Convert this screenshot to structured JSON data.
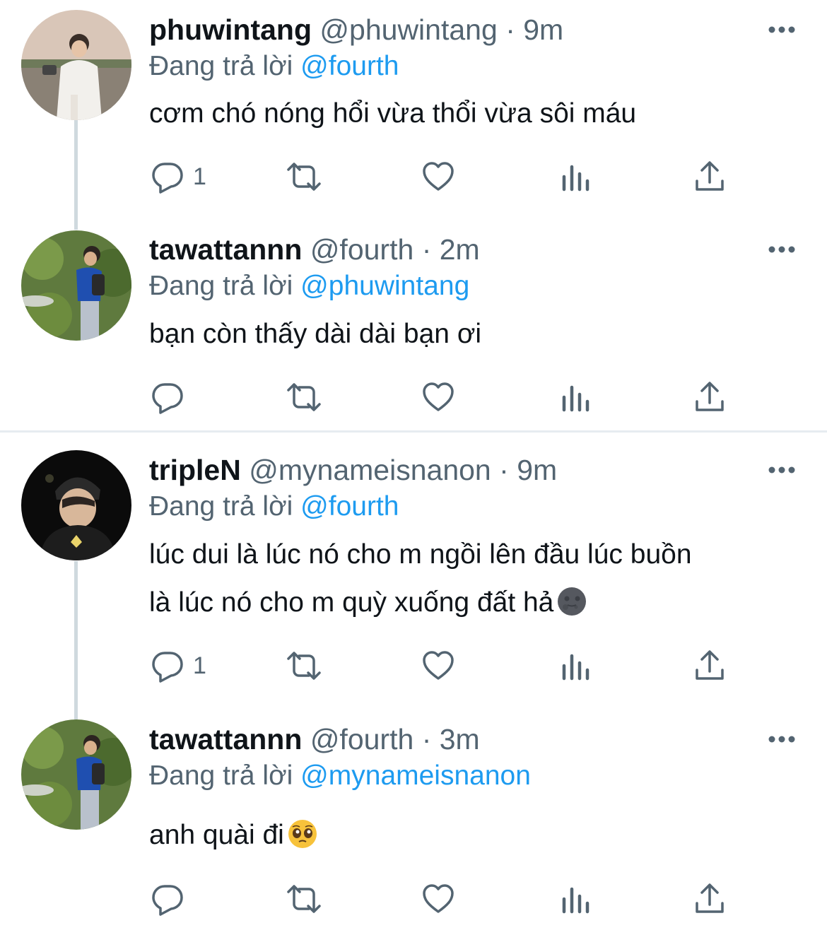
{
  "tweets": [
    {
      "name": "phuwintang",
      "handle": "@phuwintang",
      "time": "9m",
      "replying_prefix": "Đang trả lời",
      "replying_to": "@fourth",
      "text_line1": "cơm chó nóng hổi vừa thổi vừa sôi máu",
      "text_line2": "",
      "reply_count": "1"
    },
    {
      "name": "tawattannn",
      "handle": "@fourth",
      "time": "2m",
      "replying_prefix": "Đang trả lời",
      "replying_to": "@phuwintang",
      "text_line1": "bạn còn thấy dài dài bạn ơi",
      "text_line2": "",
      "reply_count": ""
    },
    {
      "name": "tripleN",
      "handle": "@mynameisnanon",
      "time": "9m",
      "replying_prefix": "Đang trả lời",
      "replying_to": "@fourth",
      "text_line1": "lúc dui là lúc nó cho m ngồi lên đầu lúc buồn",
      "text_line2": "là lúc nó cho m quỳ xuống đất hả",
      "reply_count": "1"
    },
    {
      "name": "tawattannn",
      "handle": "@fourth",
      "time": "3m",
      "replying_prefix": "Đang trả lời",
      "replying_to": "@mynameisnanon",
      "text_line1": "anh quài đi",
      "text_line2": "",
      "reply_count": ""
    }
  ],
  "separator": "·",
  "icons": {
    "reply": "reply-icon",
    "retweet": "retweet-icon",
    "like": "heart-icon",
    "analytics": "analytics-icon",
    "share": "share-icon",
    "more": "more-icon"
  },
  "colors": {
    "link": "#1d9bf0",
    "meta": "#536471",
    "text": "#0f1419",
    "thread_line": "#cfd9de"
  }
}
